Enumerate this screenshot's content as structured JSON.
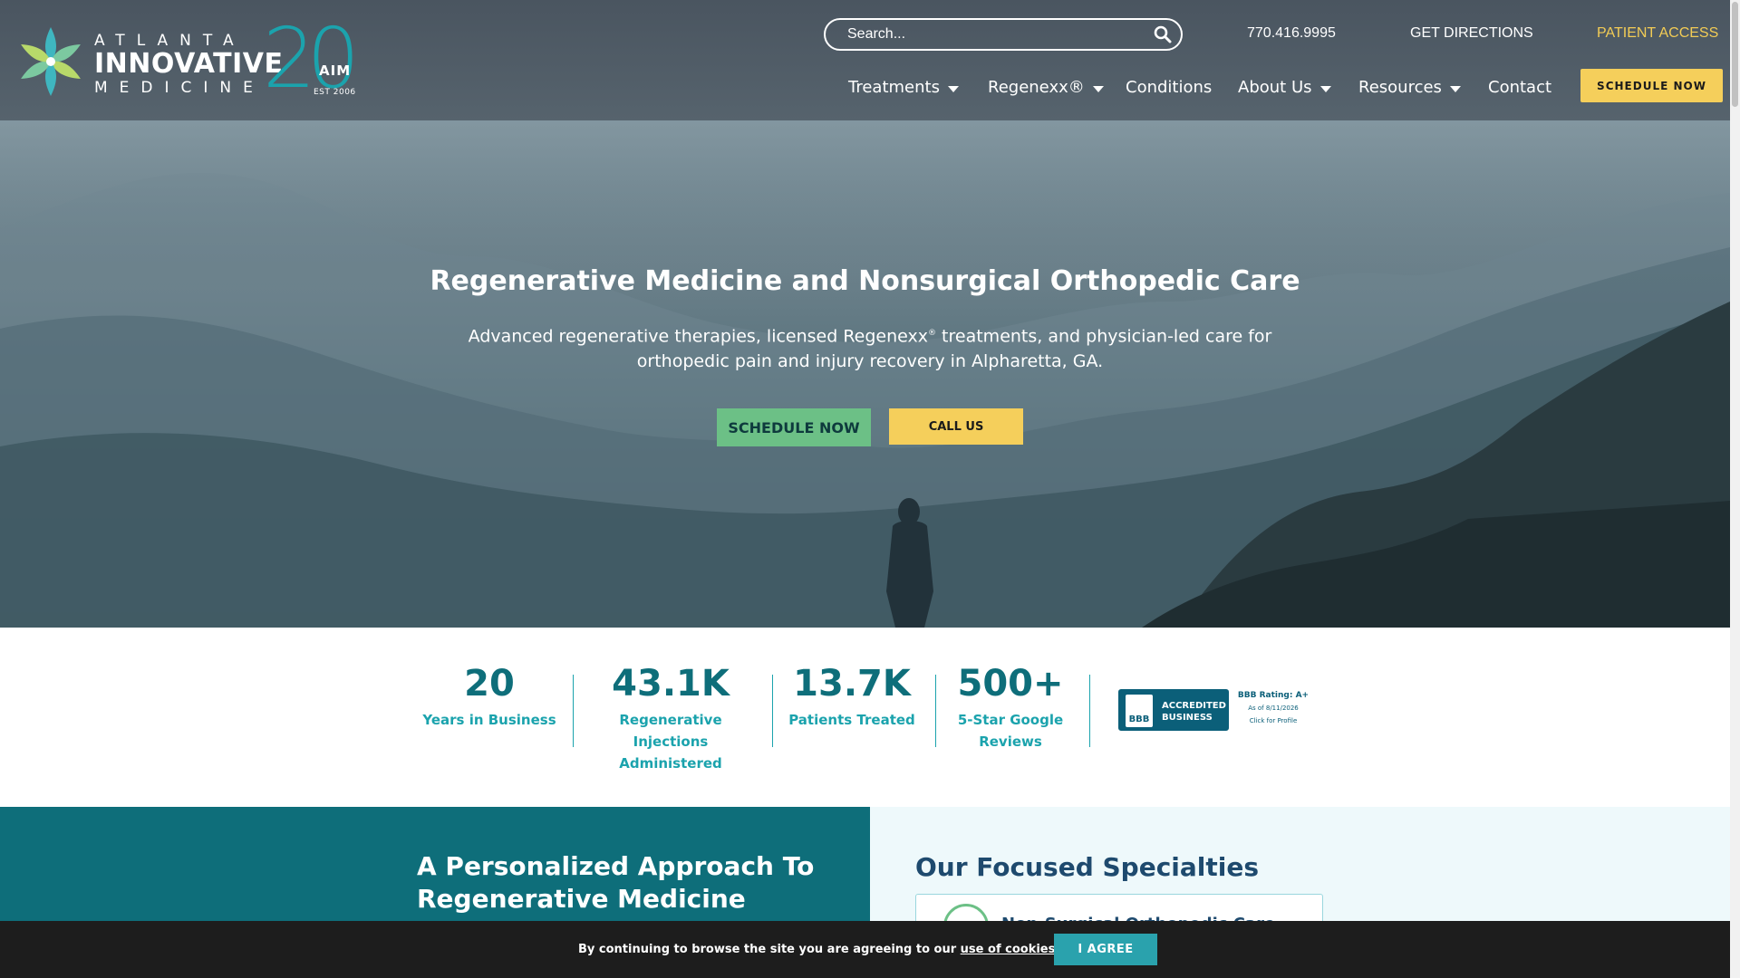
{
  "header": {
    "logo": {
      "line1": "ATLANTA",
      "line2": "INNOVATIVE",
      "line3": "MEDICINE",
      "badge_number": "20",
      "badge_text": "AIM",
      "badge_est": "EST 2006"
    },
    "search": {
      "placeholder": "Search..."
    },
    "utility_links": {
      "phone": "770.416.9995",
      "directions": "GET DIRECTIONS",
      "patient_access": "PATIENT ACCESS"
    },
    "nav": [
      {
        "label": "Treatments",
        "has_dropdown": true
      },
      {
        "label": "Regenexx®",
        "has_dropdown": true
      },
      {
        "label": "Conditions",
        "has_dropdown": false
      },
      {
        "label": "About Us",
        "has_dropdown": true
      },
      {
        "label": "Resources",
        "has_dropdown": true
      },
      {
        "label": "Contact",
        "has_dropdown": false
      }
    ],
    "schedule_button": "SCHEDULE NOW"
  },
  "hero": {
    "title": "Regenerative Medicine and Nonsurgical Orthopedic Care",
    "subtitle_part1": "Advanced regenerative therapies, licensed Regenexx",
    "subtitle_mark": "®",
    "subtitle_part2": " treatments, and physician-led care for orthopedic pain and injury recovery in Alpharetta, GA.",
    "schedule_button": "SCHEDULE NOW",
    "call_button": "CALL US"
  },
  "stats": [
    {
      "value": "20",
      "label_line1": "Years in Business",
      "label_line2": ""
    },
    {
      "value": "43.1K",
      "label_line1": "Regenerative Injections",
      "label_line2": "Administered"
    },
    {
      "value": "13.7K",
      "label_line1": "Patients Treated",
      "label_line2": ""
    },
    {
      "value": "500+",
      "label_line1": "5-Star Google",
      "label_line2": "Reviews"
    }
  ],
  "bbb": {
    "logo_text": "BBB",
    "accredited_line1": "ACCREDITED",
    "accredited_line2": "BUSINESS",
    "rating": "BBB Rating: A+",
    "as_of": "As of 8/11/2026",
    "click": "Click for Profile"
  },
  "approach": {
    "title_line1": "A Personalized Approach To",
    "title_line2": "Regenerative Medicine"
  },
  "specialties": {
    "title": "Our Focused Specialties",
    "first_card_label": "Non-Surgical Orthopedic Care"
  },
  "cookie": {
    "text": "By continuing to browse the site you are agreeing to our ",
    "link": "use of cookies",
    "suffix": ".",
    "button": "I AGREE"
  },
  "colors": {
    "header_bg": "#4f5b65",
    "teal": "#0e6e7a",
    "teal_light": "#1ba3ad",
    "yellow": "#f5cf5b",
    "green": "#6cc086",
    "cookie_bg": "#1d1d1d"
  },
  "icons": [
    "flower-logo-icon",
    "search-icon",
    "caret-down-icon",
    "bbb-torch-icon",
    "specialty-icon"
  ]
}
